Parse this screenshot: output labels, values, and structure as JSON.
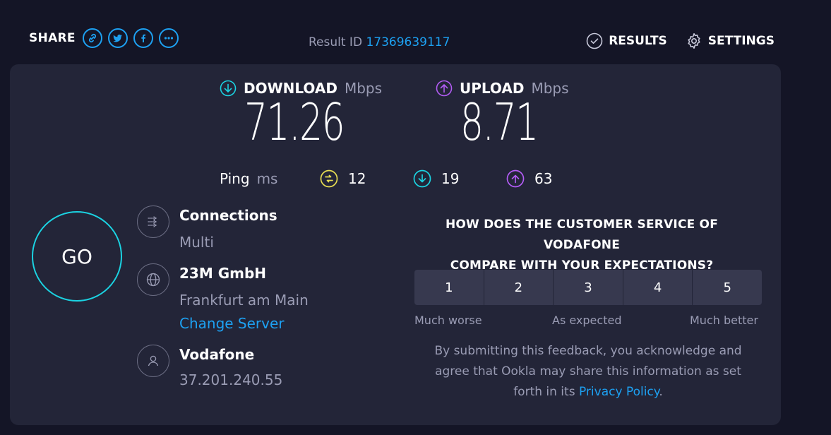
{
  "header": {
    "share_label": "SHARE",
    "share_icons": [
      "link-icon",
      "twitter-icon",
      "facebook-icon",
      "more-icon"
    ],
    "result_id_label": "Result ID",
    "result_id": "17369639117",
    "results_label": "RESULTS",
    "settings_label": "SETTINGS"
  },
  "download": {
    "label": "DOWNLOAD",
    "unit": "Mbps",
    "value": "71.26",
    "color": "#1bd3e2"
  },
  "upload": {
    "label": "UPLOAD",
    "unit": "Mbps",
    "value": "8.71",
    "color": "#b25cf4"
  },
  "ping": {
    "label": "Ping",
    "unit": "ms",
    "idle": "12",
    "download": "19",
    "upload": "63",
    "idle_color": "#e8de52"
  },
  "go_label": "GO",
  "connections": {
    "title": "Connections",
    "value": "Multi"
  },
  "server": {
    "name": "23M GmbH",
    "location": "Frankfurt am Main",
    "change_label": "Change Server"
  },
  "provider": {
    "name": "Vodafone",
    "ip": "37.201.240.55"
  },
  "survey": {
    "question_line1": "HOW DOES THE CUSTOMER SERVICE OF VODAFONE",
    "question_line2": "COMPARE WITH YOUR EXPECTATIONS?",
    "options": [
      "1",
      "2",
      "3",
      "4",
      "5"
    ],
    "legend_low": "Much worse",
    "legend_mid": "As expected",
    "legend_high": "Much better",
    "disclaimer_line1": "By submitting this feedback, you acknowledge and",
    "disclaimer_line2": "agree that Ookla may share this information as set",
    "disclaimer_pre": "forth in its",
    "privacy_label": "Privacy Policy",
    "disclaimer_post": "."
  },
  "colors": {
    "accent": "#1da1f2",
    "background": "#141526",
    "card": "#232538"
  }
}
